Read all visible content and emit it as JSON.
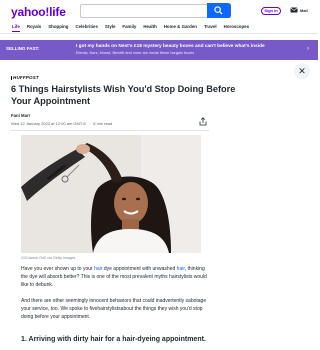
{
  "header": {
    "logo": "yahoo!life",
    "search_placeholder": "",
    "signin_label": "Sign in",
    "mail_label": "Mail"
  },
  "nav": {
    "items": [
      "Life",
      "Royals",
      "Shopping",
      "Celebrities",
      "Style",
      "Family",
      "Health",
      "Home & Garden",
      "Travel",
      "Horoscopes"
    ],
    "active": "Life"
  },
  "ad": {
    "label": "SELLING FAST:",
    "headline": "I got my hands on Next's £18 mystery beauty boxes and can't believe what's inside",
    "subline": "Elemis, Nars, Murad, Benefit and more are inside these bargain boxes"
  },
  "article": {
    "publisher": "HUFFPOST",
    "title": "6 Things Hairstylists Wish You'd Stop Doing Before Your Appointment",
    "author": "Fani Marr",
    "date": "Wed 12 January 2022 at 12:00 am GMT-8",
    "read_time": "6 min read",
    "image_caption": "GG/Jamie Grill via Getty Images",
    "para1_pre": "Have you ever shown up to your ",
    "para1_link1": "hair",
    "para1_mid": " dye appointment with unwashed ",
    "para1_link2": "hair",
    "para1_post": ", thinking the dye will absorb better? This is one of the most prevalent myths hairstylists would like to debunk.",
    "para2": "And there are other seemingly innocent behaviors that could inadvertently sabotage your service, too. We spoke to fivehairstylistsabout the things they wish you'd stop doing before your appointment.",
    "subhead": "1. Arriving with dirty hair for a hair-dyeing appointment."
  },
  "colors": {
    "brand": "#6001d2",
    "search_button": "#0f69ff",
    "ad_background": "#7759c8",
    "link": "#0f69ff"
  },
  "icons": [
    "search-icon",
    "mail-icon",
    "close-icon",
    "share-icon",
    "ad-info-icon"
  ]
}
